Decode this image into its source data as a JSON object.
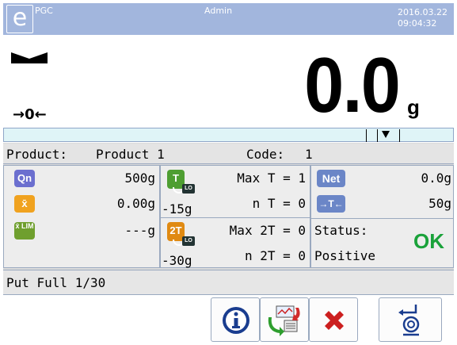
{
  "header": {
    "app_name": "PGC",
    "user": "Admin",
    "date": "2016.03.22",
    "time": "09:04:32",
    "logo_glyph": "e",
    "background_color": "#a2b6dd"
  },
  "display": {
    "zero_indicator": "→0←",
    "weight": "0.0",
    "unit": "g",
    "stable_icon": "stability-marker-icon"
  },
  "product": {
    "label": "Product:",
    "value": "Product 1",
    "code_label": "Code:",
    "code_value": "1"
  },
  "left_panel": {
    "qn_badge": "Qn",
    "qn_value": "500g",
    "xbar_badge": "x̄",
    "xbar_value": "0.00g",
    "lim_badge": "x̄ LIM",
    "lim_value": "---g"
  },
  "middle_panel": {
    "t_badge": "T",
    "t_lo": "LO",
    "t_value": "-15g",
    "max_t": "Max T = 1",
    "n_t": "n T = 0",
    "t2_badge": "2T",
    "t2_lo": "LO",
    "t2_value": "-30g",
    "max_2t": "Max 2T = 0",
    "n_2t": "n 2T = 0"
  },
  "right_panel": {
    "net_badge": "Net",
    "net_value": "0.0g",
    "tare_badge": "→T←",
    "tare_value": "50g",
    "status_label": "Status:",
    "status_value": "Positive",
    "status_ok": "OK",
    "ok_color": "#1aa23a"
  },
  "progress": {
    "text": "Put Full 1/30"
  },
  "buttons": {
    "info_icon": "info-icon",
    "export_icon": "export-report-icon",
    "cancel_icon": "cancel-icon",
    "tare_icon": "tare-reset-icon"
  }
}
